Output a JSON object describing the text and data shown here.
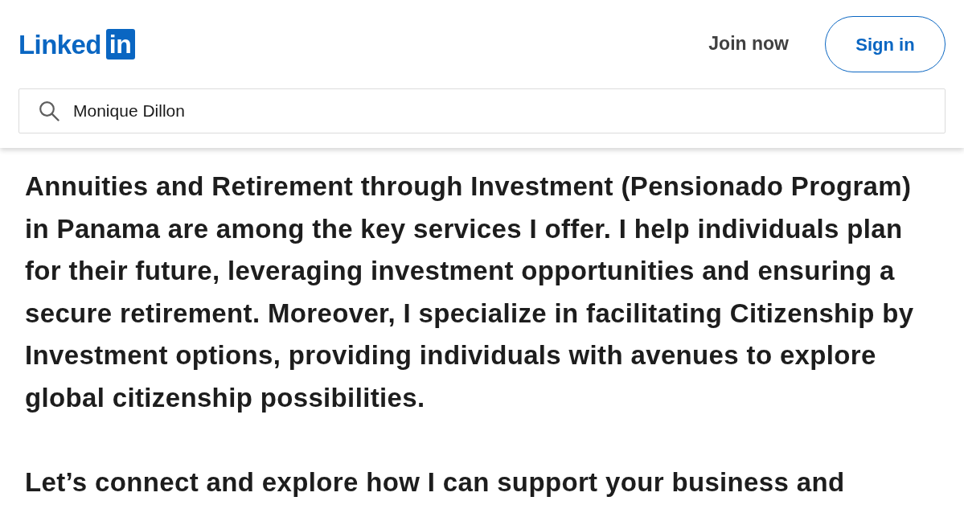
{
  "header": {
    "logo": {
      "word": "Linked",
      "mark": "in"
    },
    "actions": [
      {
        "kind": "link",
        "label": "Join now"
      },
      {
        "kind": "outline",
        "label": "Sign in"
      }
    ],
    "search": {
      "value": "Monique Dillon"
    }
  },
  "about": {
    "paragraphs": [
      "Annuities and Retirement through Investment (Pensionado Program) in Panama are among the key services I offer. I help individuals plan for their future, leveraging investment opportunities and ensuring a secure retirement. Moreover, I specialize in facilitating Citizenship by Investment options, providing individuals with avenues to explore global citizenship possibilities.",
      "Let’s connect and explore how I can support your business and"
    ]
  }
}
